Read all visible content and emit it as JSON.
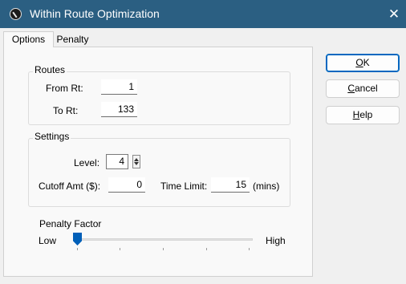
{
  "window": {
    "title": "Within Route Optimization",
    "close_glyph": "✕"
  },
  "tabs": [
    {
      "label": "Options"
    },
    {
      "label": "Penalty"
    }
  ],
  "routes": {
    "title": "Routes",
    "from_label": "From Rt:",
    "from_value": "1",
    "to_label": "To Rt:",
    "to_value": "133"
  },
  "settings": {
    "title": "Settings",
    "level_label": "Level:",
    "level_value": "4",
    "cutoff_label": "Cutoff Amt ($):",
    "cutoff_value": "0",
    "time_limit_label": "Time Limit:",
    "time_limit_value": "15",
    "time_limit_unit": "(mins)"
  },
  "penalty": {
    "title": "Penalty Factor",
    "low_label": "Low",
    "high_label": "High",
    "position_fraction": 0
  },
  "buttons": {
    "ok": {
      "mnemonic": "O",
      "rest": "K"
    },
    "cancel": {
      "mnemonic": "C",
      "rest": "ancel"
    },
    "help": {
      "mnemonic": "H",
      "rest": "elp"
    }
  },
  "colors": {
    "titlebar": "#2b5f82",
    "accent": "#005fb8"
  }
}
